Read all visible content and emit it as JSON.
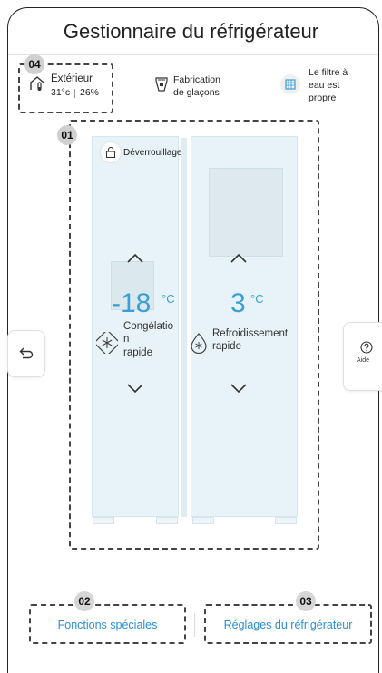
{
  "header": {
    "title": "Gestionnaire du réfrigérateur"
  },
  "badges": {
    "b01": "01",
    "b02": "02",
    "b03": "03",
    "b04": "04"
  },
  "outdoor": {
    "label": "Extérieur",
    "temp": "31°c",
    "humidity": "26%"
  },
  "ice": {
    "label_line1": "Fabrication",
    "label_line2": "de glaçons"
  },
  "filter": {
    "line1": "Le filtre à",
    "line2": "eau est",
    "line3": "propre"
  },
  "freezer": {
    "unlock_label": "Déverrouillage",
    "temp": "-18",
    "unit": "°C",
    "mode_line1": "Congélatio",
    "mode_line2": "n",
    "mode_line3": "rapide"
  },
  "fridge": {
    "temp": "3",
    "unit": "°C",
    "mode_line1": "Refroidissement",
    "mode_line2": "rapide"
  },
  "side": {
    "help_label": "Aide"
  },
  "bottom": {
    "special": "Fonctions spéciales",
    "settings": "Réglages du réfrigérateur"
  },
  "icons": {
    "home": "home-thermometer-icon",
    "ice": "ice-maker-icon",
    "filter": "water-filter-icon",
    "lock": "lock-open-icon",
    "back": "back-arrow-icon",
    "help": "help-icon",
    "snowflake": "snowflake-icon",
    "drop": "water-drop-icon"
  },
  "colors": {
    "accent": "#3a9fd6",
    "fridge_bg": "#e7f3f8"
  }
}
